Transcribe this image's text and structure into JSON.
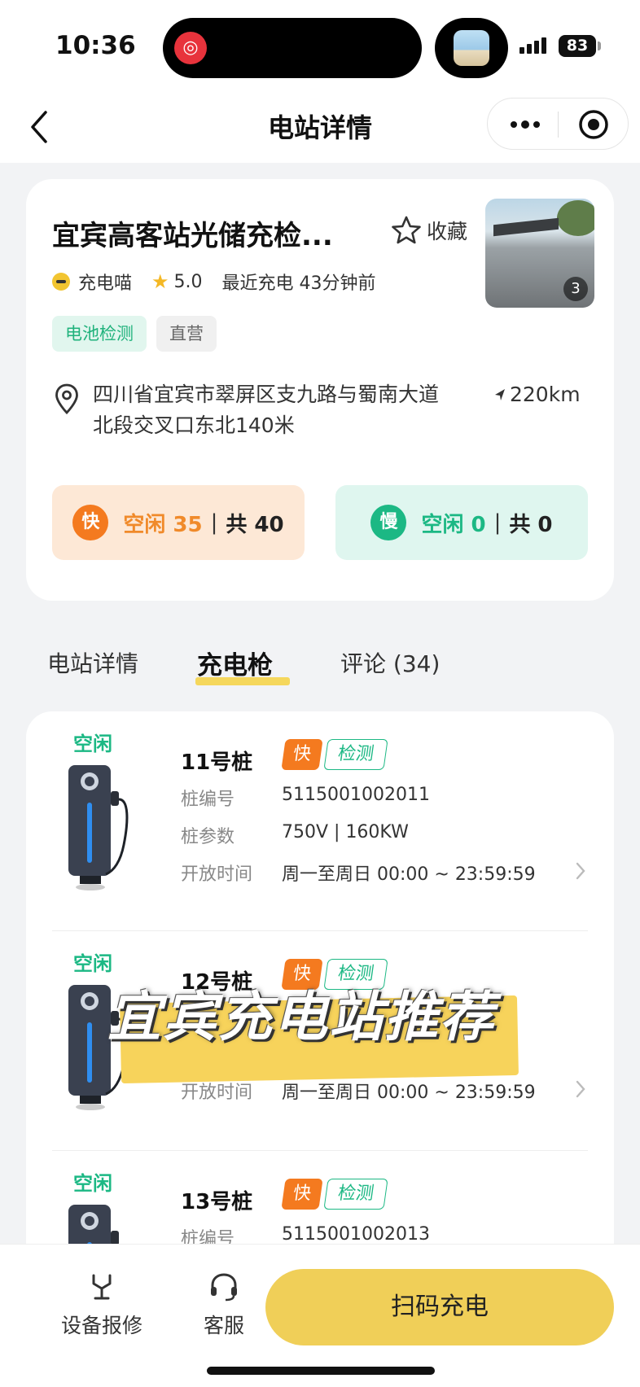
{
  "status_bar": {
    "time": "10:36",
    "battery": "83"
  },
  "nav": {
    "title": "电站详情"
  },
  "station": {
    "name": "宜宾高客站光储充检...",
    "favorite_label": "收藏",
    "photo_count": "3",
    "brand": "充电喵",
    "rating": "5.0",
    "recent_charge": "最近充电 43分钟前",
    "tags": [
      "电池检测",
      "直营"
    ],
    "address": "四川省宜宾市翠屏区支九路与蜀南大道北段交叉口东北140米",
    "distance": "220km",
    "fast": {
      "badge": "快",
      "free_label": "空闲 35",
      "sep": "|",
      "total_label": "共 40"
    },
    "slow": {
      "badge": "慢",
      "free_label": "空闲 0",
      "sep": "|",
      "total_label": "共 0"
    }
  },
  "tabs": [
    "电站详情",
    "充电枪",
    "评论 (34)"
  ],
  "piles": [
    {
      "status": "空闲",
      "name": "11号桩",
      "tag_fast": "快",
      "tag_check": "检测",
      "rows": [
        {
          "label": "桩编号",
          "value": "5115001002011"
        },
        {
          "label": "桩参数",
          "value": "750V | 160KW"
        },
        {
          "label": "开放时间",
          "value": "周一至周日 00:00 ~ 23:59:59"
        }
      ]
    },
    {
      "status": "空闲",
      "name": "12号桩",
      "tag_fast": "快",
      "tag_check": "检测",
      "rows": [
        {
          "label": "开放时间",
          "value": "周一至周日 00:00 ~ 23:59:59"
        }
      ]
    },
    {
      "status": "空闲",
      "name": "13号桩",
      "tag_fast": "快",
      "tag_check": "检测",
      "rows": [
        {
          "label": "桩编号",
          "value": "5115001002013"
        }
      ]
    }
  ],
  "overlay": {
    "text": "宜宾充电站推荐"
  },
  "bottom_bar": {
    "repair": "设备报修",
    "service": "客服",
    "scan": "扫码充电"
  },
  "colors": {
    "accent_yellow": "#f0cf58",
    "fast_orange": "#f47a1f",
    "slow_green": "#1cb884"
  },
  "icons": [
    "back-icon",
    "more-icon",
    "target-icon",
    "star-outline-icon",
    "star-icon",
    "location-icon",
    "navigate-arrow-icon",
    "chevron-right-icon",
    "wrench-icon",
    "headset-icon"
  ]
}
